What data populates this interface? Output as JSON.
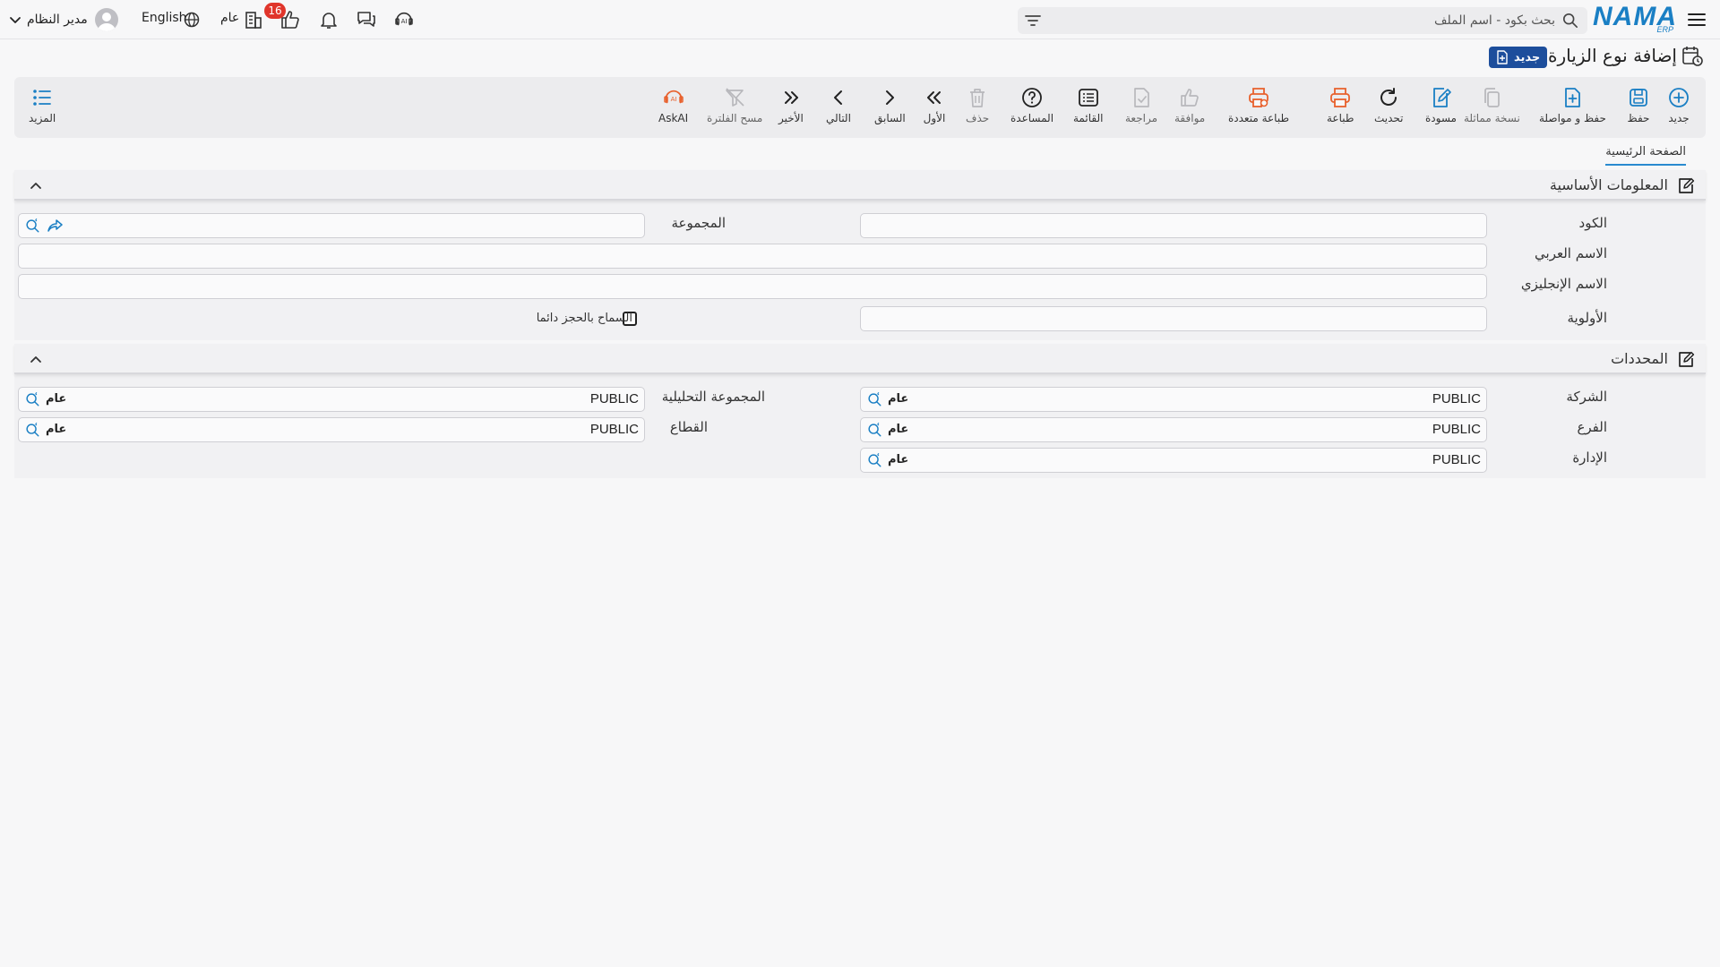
{
  "topbar": {
    "logo_text": "NAMA",
    "logo_sub": "ERP",
    "search_placeholder": "بحث بكود - اسم الملف",
    "notification_count": "16",
    "branch_label": "عام",
    "language_label": "English",
    "user_name": "مدير النظام"
  },
  "page": {
    "title": "إضافة نوع الزيارة",
    "status_badge": "جديد"
  },
  "toolbar": {
    "new": "جديد",
    "save": "حفظ",
    "save_continue": "حفظ و مواصلة",
    "duplicate": "نسخة مماثلة",
    "draft": "مسودة",
    "refresh": "تحديث",
    "print": "طباعة",
    "multi_print": "طباعة متعددة",
    "approve": "موافقة",
    "review": "مراجعة",
    "list": "القائمة",
    "help": "المساعدة",
    "delete": "حذف",
    "first": "الأول",
    "previous": "السابق",
    "next": "التالي",
    "last": "الأخير",
    "clear_filter": "مسح الفلترة",
    "ask_ai": "AskAI",
    "more": "المزيد"
  },
  "tabs": {
    "main": "الصفحة الرئيسية"
  },
  "basic_info": {
    "title": "المعلومات الأساسية",
    "code_label": "الكود",
    "code_value": "",
    "group_label": "المجموعة",
    "group_value": "",
    "arabic_name_label": "الاسم العربي",
    "arabic_name_value": "",
    "english_name_label": "الاسم الإنجليزي",
    "english_name_value": "",
    "priority_label": "الأولوية",
    "priority_value": "",
    "allow_booking_label": "السماح بالحجز دائما"
  },
  "specifiers": {
    "title": "المحددات",
    "company_label": "الشركة",
    "company_code": "PUBLIC",
    "company_name": "عام",
    "analytic_group_label": "المجموعة التحليلية",
    "analytic_group_code": "PUBLIC",
    "analytic_group_name": "عام",
    "branch_label": "الفرع",
    "branch_code": "PUBLIC",
    "branch_name": "عام",
    "sector_label": "القطاع",
    "sector_code": "PUBLIC",
    "sector_name": "عام",
    "department_label": "الإدارة",
    "department_code": "PUBLIC",
    "department_name": "عام"
  },
  "colors": {
    "accent": "#1a7fc4",
    "badge_blue": "#1d4e9c",
    "print_orange": "#e8602c",
    "notification_red": "#e0352b"
  }
}
